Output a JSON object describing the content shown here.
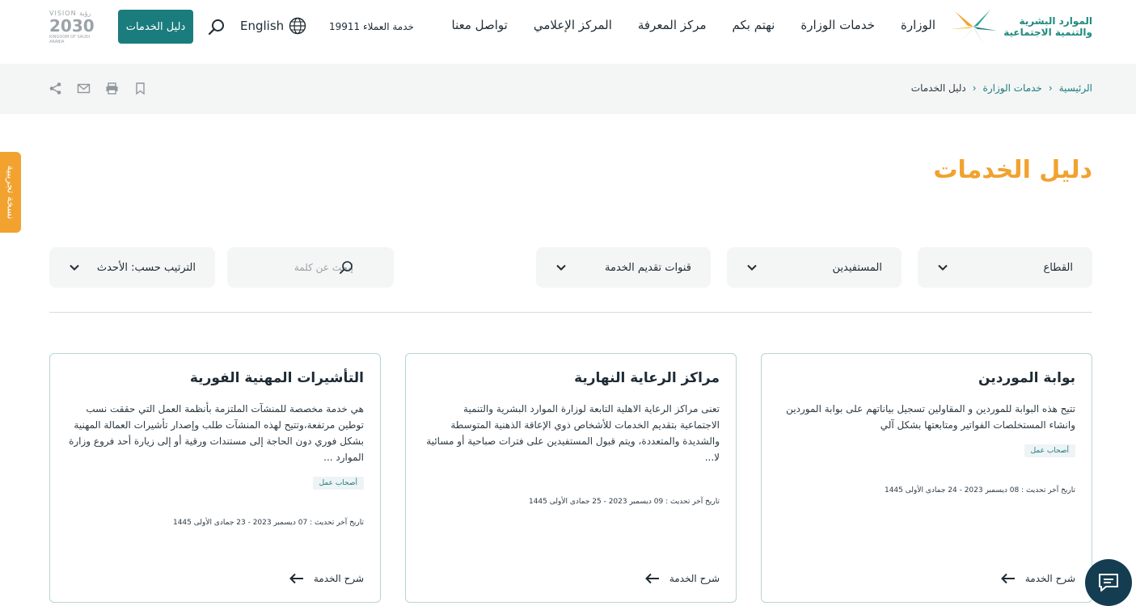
{
  "header": {
    "logo_line1": "الموارد البشرية",
    "logo_line2": "والتنمية الاجتماعية",
    "nav": [
      "الوزارة",
      "خدمات الوزارة",
      "نهتم بكم",
      "مركز المعرفة",
      "المركز الإعلامي",
      "تواصل معنا"
    ],
    "customer_service": "خدمة العملاء 19911",
    "language": "English",
    "guide_button": "دليل الخدمات",
    "vision_top": "VISION رؤية",
    "vision_year": "2030",
    "vision_sub": "KINGDOM OF SAUDI ARABIA"
  },
  "breadcrumb": {
    "home": "الرئيسية",
    "services": "خدمات الوزارة",
    "current": "دليل الخدمات",
    "separator": "‹"
  },
  "side_tab": "نسخة تجريبية",
  "page_title": "دليل الخدمات",
  "filters": {
    "sector": "القطاع",
    "beneficiaries": "المستفيدين",
    "channels": "قنوات تقديم الخدمة",
    "search_placeholder": "إبحث عن كلمة",
    "sort": "الترتيب حسب: الأحدث"
  },
  "cards": [
    {
      "title": "بوابة الموردين",
      "desc": "تتيح هذه البوابة للموردين و المقاولين تسجيل بياناتهم على بوابة الموردين وانشاء المستخلصات الفواتير ومتابعتها بشكل آلي",
      "tag": "أصحاب عمل",
      "updated": "تاريخ آخر تحديث : 08 ديسمبر 2023 - 24 جمادى الأولى 1445",
      "explain": "شرح الخدمة"
    },
    {
      "title": "مراكز الرعاية النهارية",
      "desc": "تعنى مراكز الرعاية الاهلية التابعة لوزارة الموارد البشرية والتنمية الاجتماعية بتقديم الخدمات للأشخاص ذوي الإعاقة الذهنية المتوسطة والشديدة والمتعددة، ويتم قبول المستفيدين على فترات صباحية أو مسائية لا...",
      "tag": "",
      "updated": "تاريخ آخر تحديث : 09 ديسمبر 2023 - 25 جمادى الأولى 1445",
      "explain": "شرح الخدمة"
    },
    {
      "title": "التأشيرات المهنية الفورية",
      "desc": "هي خدمة مخصصة للمنشآت الملتزمة بأنظمة العمل التي حققت نسب توطين مرتفعة،وتتيح لهذه المنشآت طلب وإصدار تأشيرات العمالة المهنية بشكل فوري دون الحاجة إلى مستندات ورقية أو إلى زيارة أحد فروع وزارة الموارد ...",
      "tag": "أصحاب عمل",
      "updated": "تاريخ آخر تحديث : 07 ديسمبر 2023 - 23 جمادى الأولى 1445",
      "explain": "شرح الخدمة"
    }
  ],
  "colors": {
    "primary": "#1b7c7d",
    "accent": "#f1a22f",
    "chat": "#153d52"
  }
}
